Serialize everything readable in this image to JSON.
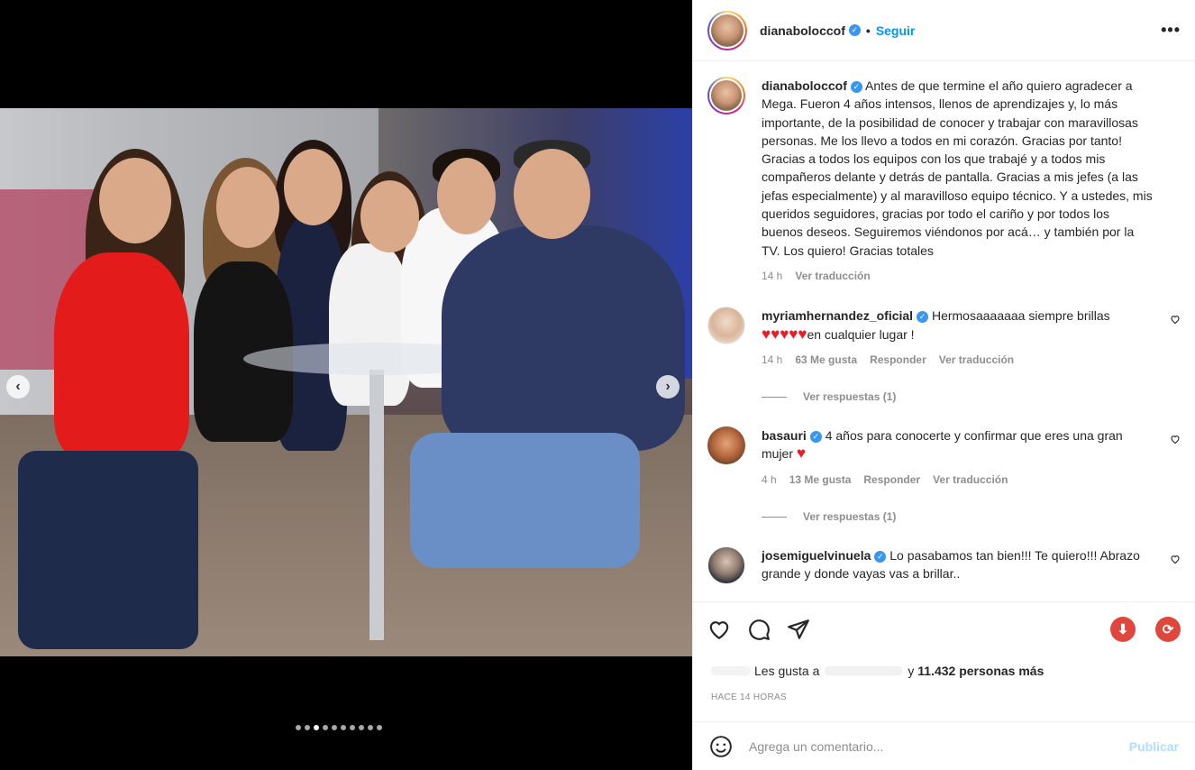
{
  "post": {
    "username": "dianaboloccof",
    "follow_label": "Seguir",
    "separator": "•",
    "more_label": "•••",
    "carousel": {
      "prev": "‹",
      "next": "›",
      "slide_count": 10,
      "active_index": 2
    }
  },
  "caption": {
    "username": "dianaboloccof",
    "text": "Antes de que termine el año quiero agradecer a Mega. Fueron 4 años intensos, llenos de aprendizajes y, lo más importante, de la posibilidad de conocer y trabajar con maravillosas personas. Me los llevo a todos en mi corazón. Gracias por tanto! Gracias a todos los equipos con los que trabajé y a todos mis compañeros delante y detrás de pantalla. Gracias a mis jefes (a las jefas especialmente) y al maravilloso equipo técnico. Y a ustedes, mis queridos seguidores, gracias por todo el cariño y por todos los buenos deseos. Seguiremos viéndonos por acá… y también por la TV. Los quiero! Gracias totales",
    "time": "14 h",
    "translate": "Ver traducción"
  },
  "comments": [
    {
      "username": "myriamhernandez_oficial",
      "text_before": "Hermosaaaaaaa siempre brillas",
      "hearts": "♥♥♥♥♥",
      "text_after": "en cualquier lugar !",
      "time": "14 h",
      "likes": "63 Me gusta",
      "reply": "Responder",
      "translate": "Ver traducción",
      "replies": "Ver respuestas (1)"
    },
    {
      "username": "basauri",
      "text_before": "4 años para conocerte y confirmar que eres una gran mujer",
      "hearts": "♥",
      "text_after": "",
      "time": "4 h",
      "likes": "13 Me gusta",
      "reply": "Responder",
      "translate": "Ver traducción",
      "replies": "Ver respuestas (1)"
    },
    {
      "username": "josemiguelvinuela",
      "text_before": "Lo pasabamos tan bien!!! Te quiero!!! Abrazo grande y donde vayas vas a brillar..",
      "hearts": "",
      "text_after": ""
    }
  ],
  "likes": {
    "prefix": "Les gusta a",
    "suffix": "y",
    "count": "11.432 personas más"
  },
  "timestamp": "HACE 14 HORAS",
  "composer": {
    "placeholder": "Agrega un comentario...",
    "publish": "Publicar"
  },
  "colors": {
    "link": "#0095f6",
    "verified": "#3897f0",
    "heart": "#ed1c24"
  }
}
